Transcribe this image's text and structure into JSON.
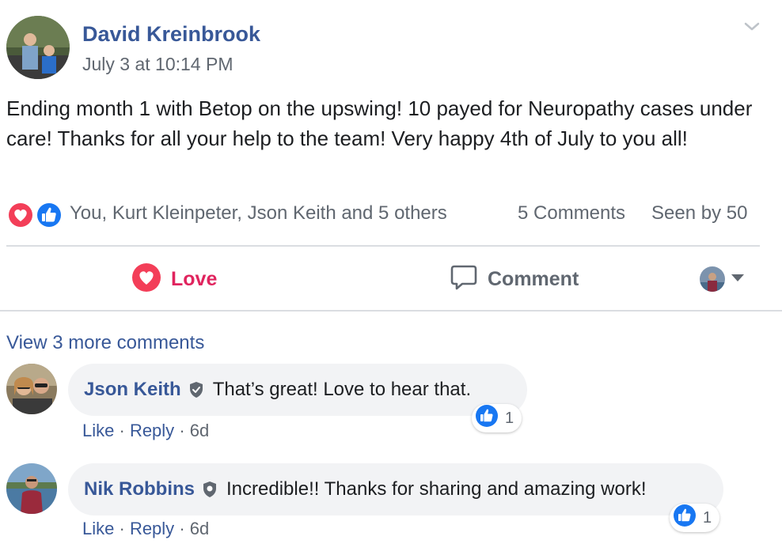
{
  "post": {
    "author": "David Kreinbrook",
    "timestamp": "July 3 at 10:14 PM",
    "body": "Ending month 1 with Betop on the upswing! 10 payed for Neuropathy cases under care! Thanks for all your help to the team! Very happy 4th of July to you all!",
    "menu_icon": "chevron-down-icon"
  },
  "reactions": {
    "icons": [
      "love-reaction-icon",
      "like-reaction-icon"
    ],
    "names": "You, Kurt Kleinpeter, Json Keith and 5 others",
    "comments_count": "5 Comments",
    "seen_by": "Seen by 50"
  },
  "actions": {
    "love_label": "Love",
    "comment_label": "Comment"
  },
  "comments": {
    "view_more": "View 3 more comments",
    "items": [
      {
        "name": "Json Keith",
        "text": "That’s great! Love to hear that.",
        "like": "Like",
        "reply": "Reply",
        "age": "6d",
        "reaction_count": "1"
      },
      {
        "name": "Nik Robbins",
        "text": "Incredible!! Thanks for sharing and amazing work!",
        "like": "Like",
        "reply": "Reply",
        "age": "6d",
        "reaction_count": "1"
      }
    ]
  },
  "colors": {
    "link_blue": "#385898",
    "love_red": "#e0245e",
    "like_blue": "#1877f2",
    "muted_text": "#606770",
    "bubble_bg": "#f2f3f5"
  }
}
